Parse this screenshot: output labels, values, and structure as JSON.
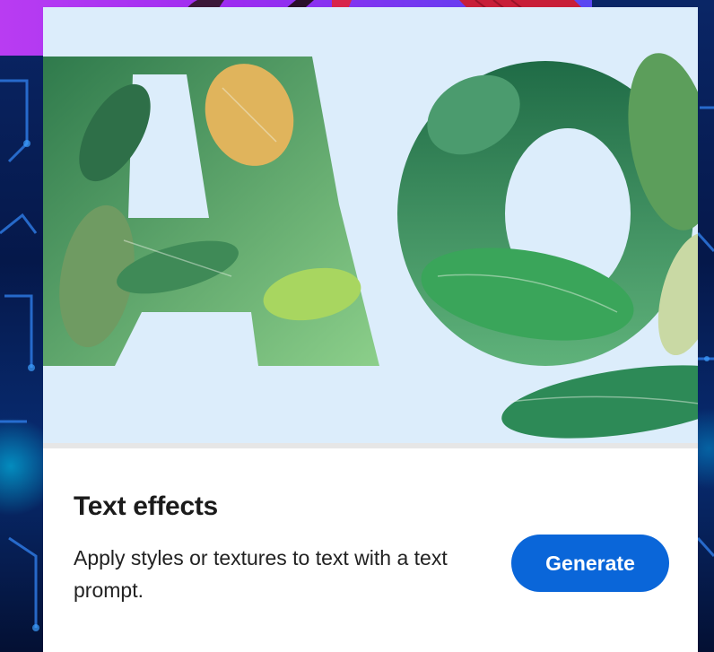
{
  "card": {
    "title": "Text effects",
    "description": "Apply styles or textures to text with a text prompt.",
    "generate_label": "Generate",
    "image_icon": "leafy-text-effect-sample"
  },
  "colors": {
    "accent": "#0a66d9",
    "banner": "#9c2cf0",
    "card_image_bg": "#dcedfb",
    "background": "#071a4a"
  }
}
